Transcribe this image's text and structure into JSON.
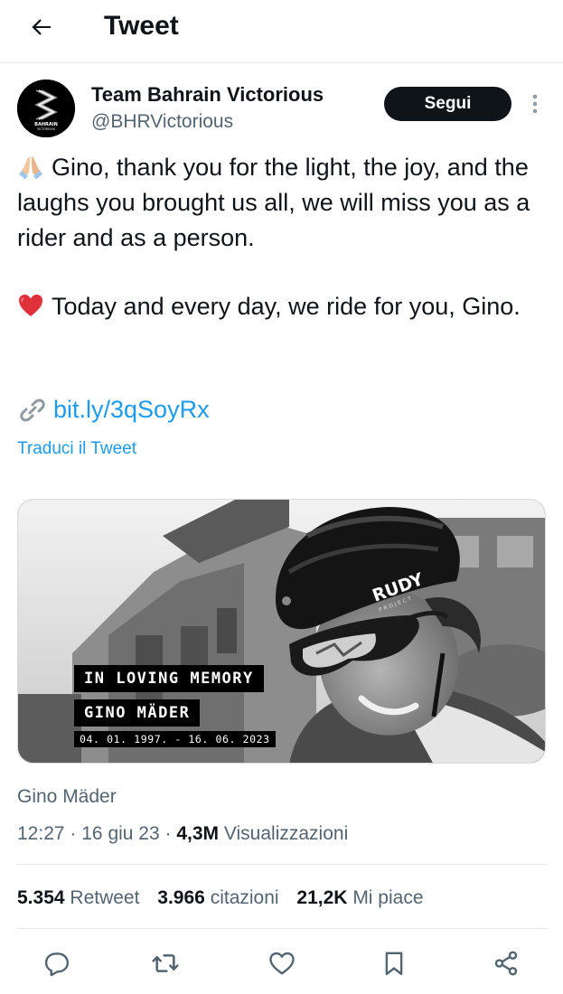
{
  "header": {
    "title": "Tweet",
    "back_icon": "arrow-left-icon"
  },
  "author": {
    "name": "Team Bahrain Victorious",
    "handle": "@BHRVictorious",
    "avatar_text_1": "BAHRAIN",
    "avatar_text_2": "VICTORIOUS"
  },
  "follow_label": "Segui",
  "more_icon": "more-vertical-icon",
  "tweet": {
    "para1_emoji": "folded-hands-emoji",
    "para1": "Gino, thank you for the light, the joy, and the laughs you brought us all, we will miss you as a rider and as a person.",
    "para2_emoji": "red-heart-emoji",
    "para2": "Today and every day, we ride for you, Gino.",
    "link_icon": "link-icon",
    "link": "bit.ly/3qSoyRx",
    "translate": "Traduci il Tweet"
  },
  "media": {
    "line1": "IN LOVING MEMORY",
    "line2": "GINO MÄDER",
    "dates": "04. 01. 1997. - 16. 06. 2023",
    "helmet_brand": "RUDY",
    "helmet_sub": "PROJECT"
  },
  "caption": "Gino Mäder",
  "meta": {
    "time": "12:27",
    "date": "16 giu 23",
    "views_count": "4,3M",
    "views_label": "Visualizzazioni",
    "sep": "·"
  },
  "stats": {
    "retweets_count": "5.354",
    "retweets_label": "Retweet",
    "quotes_count": "3.966",
    "quotes_label": "citazioni",
    "likes_count": "21,2K",
    "likes_label": "Mi piace"
  },
  "actions": [
    "reply-icon",
    "retweet-icon",
    "like-icon",
    "bookmark-icon",
    "share-icon"
  ],
  "colors": {
    "link": "#1d9bf0",
    "text": "#0f1419",
    "secondary": "#536471",
    "follow_bg": "#0f1419"
  }
}
